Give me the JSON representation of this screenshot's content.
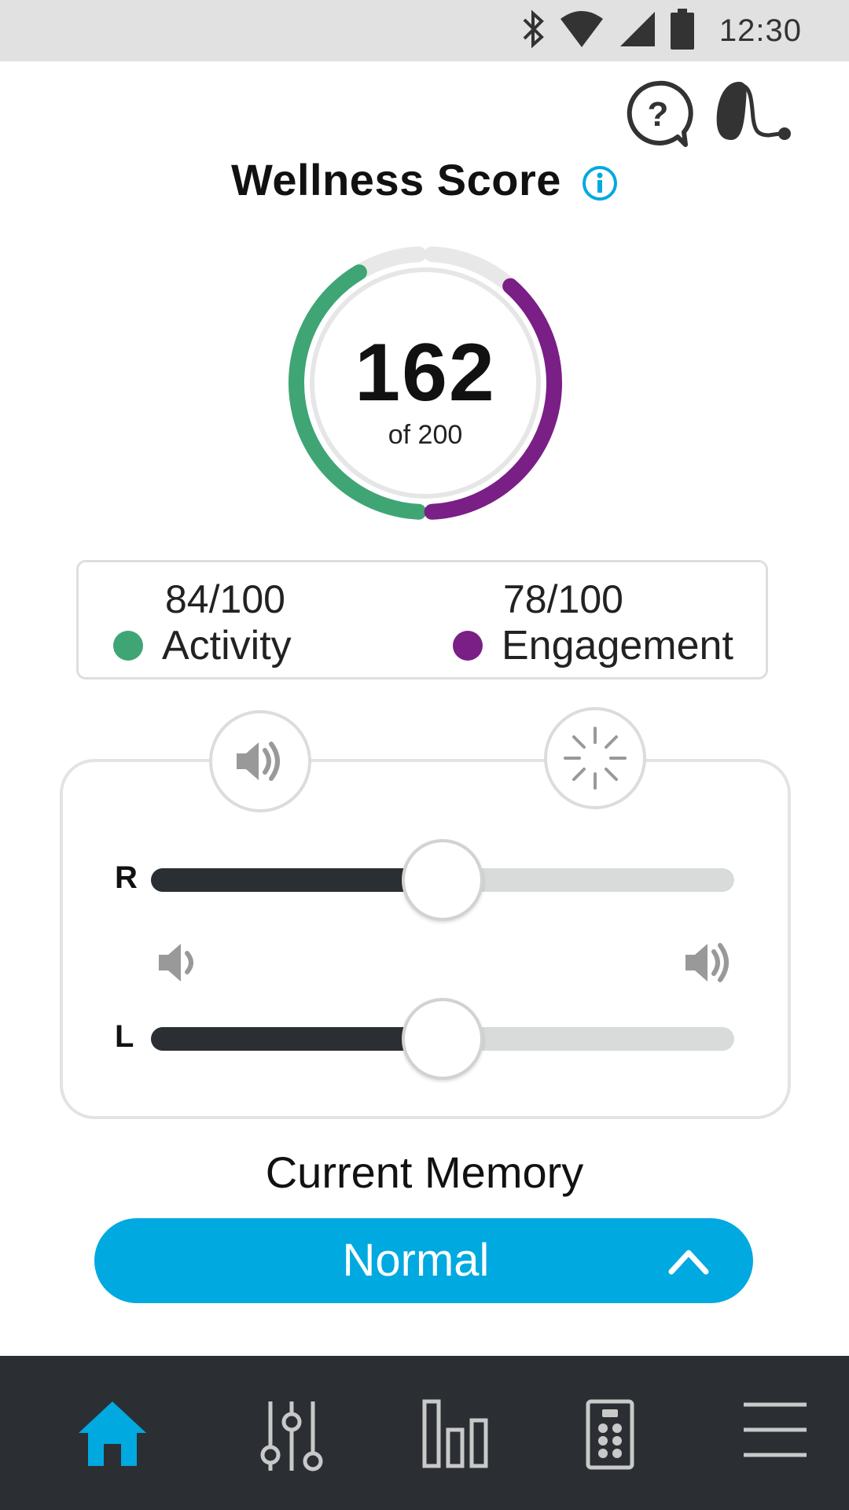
{
  "status_bar": {
    "time": "12:30",
    "icons": [
      "bluetooth-icon",
      "wifi-icon",
      "cell-signal-icon",
      "battery-icon"
    ]
  },
  "header": {
    "icons": [
      "help-icon",
      "hearing-aid-icon"
    ]
  },
  "wellness": {
    "title": "Wellness Score",
    "score": "162",
    "max_label": "of 200",
    "activity_value": "84/100",
    "activity_label": "Activity",
    "engagement_value": "78/100",
    "engagement_label": "Engagement",
    "activity_fraction": 0.84,
    "engagement_fraction": 0.78
  },
  "volume": {
    "right_label": "R",
    "left_label": "L",
    "right_level": 0.5,
    "left_level": 0.5,
    "mode_icons": [
      "volume-icon",
      "sparkle-icon"
    ]
  },
  "memory": {
    "label": "Current Memory",
    "value": "Normal"
  },
  "bottom_nav": {
    "items": [
      "home-icon",
      "equalizer-icon",
      "stats-icon",
      "remote-icon",
      "menu-icon"
    ],
    "active": "home-icon"
  },
  "colors": {
    "activity": "#3fa574",
    "engagement": "#7a1f86",
    "accent": "#00a9df",
    "nav_bg": "#2b2f33",
    "track_fill": "#2b2f33",
    "track_empty": "#d9dbdb"
  }
}
